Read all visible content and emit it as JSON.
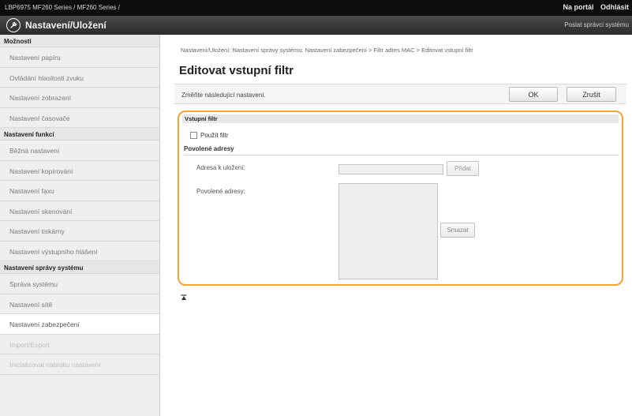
{
  "topbar": {
    "device_name": "LBP6975    MF260 Series / MF260 Series /",
    "portal_link": "Na portál",
    "logout_link": "Odhlásit"
  },
  "header": {
    "title": "Nastavení/Uložení",
    "send_link": "Poslat správci systému",
    "logo_icon": "settings-wrench-icon"
  },
  "sidebar": {
    "sections": [
      {
        "title": "Možnosti",
        "items": [
          {
            "label": "Nastavení papíru",
            "state": "normal"
          },
          {
            "label": "Ovládání hlasitosti zvuku",
            "state": "normal"
          },
          {
            "label": "Nastavení zobrazení",
            "state": "normal"
          },
          {
            "label": "Nastavení časovače",
            "state": "normal"
          }
        ]
      },
      {
        "title": "Nastavení funkcí",
        "items": [
          {
            "label": "Běžná nastavení",
            "state": "normal"
          },
          {
            "label": "Nastavení kopírování",
            "state": "normal"
          },
          {
            "label": "Nastavení faxu",
            "state": "normal"
          },
          {
            "label": "Nastavení skenování",
            "state": "normal"
          },
          {
            "label": "Nastavení tiskárny",
            "state": "normal"
          },
          {
            "label": "Nastavení výstupního hlášení",
            "state": "normal"
          }
        ]
      },
      {
        "title": "Nastavení správy systému",
        "items": [
          {
            "label": "Správa systému",
            "state": "normal"
          },
          {
            "label": "Nastavení sítě",
            "state": "normal"
          },
          {
            "label": "Nastavení zabezpečení",
            "state": "active"
          },
          {
            "label": "Import/Export",
            "state": "faded"
          },
          {
            "label": "Inicializovat nabídku nastavení",
            "state": "faded"
          }
        ]
      }
    ]
  },
  "main": {
    "breadcrumb": "Nastavení/Uložení: Nastavení správy systému: Nastavení zabezpečení > Filtr adres MAC > Editovat vstupní filtr",
    "title": "Editovat vstupní filtr",
    "instruction": "Změňte následující nastavení.",
    "ok_label": "OK",
    "cancel_label": "Zrušit",
    "panel": {
      "header": "Vstupní filtr",
      "use_filter_label": "Použít filtr",
      "use_filter_checked": false,
      "allowed_header": "Povolené adresy",
      "address_label": "Adresa k uložení:",
      "address_value": "",
      "add_label": "Přidat",
      "allowed_label": "Povolené adresy:",
      "allowed_addresses": [],
      "delete_label": "Smazat"
    },
    "top_icon": "scroll-to-top-icon"
  },
  "colors": {
    "panel_highlight": "#f3a536",
    "topbar": "#0d0d0d",
    "header": "#3a3a3a",
    "sidebar_bg": "#efefef"
  }
}
